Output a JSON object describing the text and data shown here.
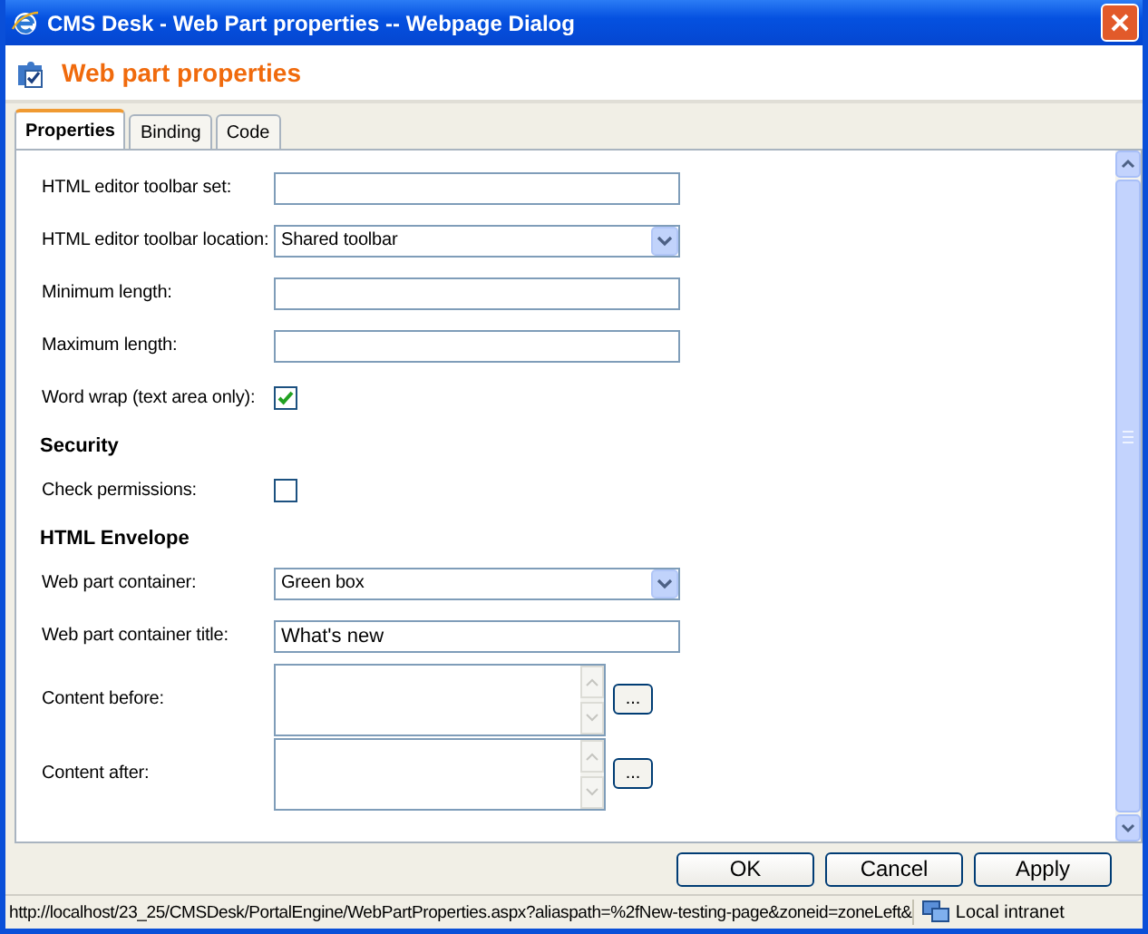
{
  "window": {
    "title": "CMS Desk - Web Part properties -- Webpage Dialog"
  },
  "header": {
    "title": "Web part properties"
  },
  "tabs": [
    {
      "label": "Properties",
      "selected": true
    },
    {
      "label": "Binding",
      "selected": false
    },
    {
      "label": "Code",
      "selected": false
    }
  ],
  "sections": [
    {
      "fields": [
        {
          "kind": "text",
          "label": "HTML editor toolbar set:"
        },
        {
          "kind": "select",
          "label": "HTML editor toolbar location:",
          "value": "Shared toolbar"
        },
        {
          "kind": "text",
          "label": "Minimum length:"
        },
        {
          "kind": "text",
          "label": "Maximum length:"
        },
        {
          "kind": "checkbox",
          "label": "Word wrap (text area only):",
          "checked": true
        }
      ]
    },
    {
      "heading": "Security",
      "fields": [
        {
          "kind": "checkbox",
          "label": "Check permissions:",
          "checked": false
        }
      ]
    },
    {
      "heading": "HTML Envelope",
      "fields": [
        {
          "kind": "select",
          "label": "Web part container:",
          "value": "Green box"
        },
        {
          "kind": "text",
          "label": "Web part container title:",
          "value": "What's new"
        },
        {
          "kind": "textarea",
          "label": "Content before:",
          "button": "..."
        },
        {
          "kind": "textarea",
          "label": "Content after:",
          "button": "..."
        }
      ]
    }
  ],
  "buttons": [
    "OK",
    "Cancel",
    "Apply"
  ],
  "status_bar": {
    "url": "http://localhost/23_25/CMSDesk/PortalEngine/WebPartProperties.aspx?aliaspath=%2fNew-testing-page&zoneid=zoneLeft&",
    "zone": "Local intranet"
  }
}
